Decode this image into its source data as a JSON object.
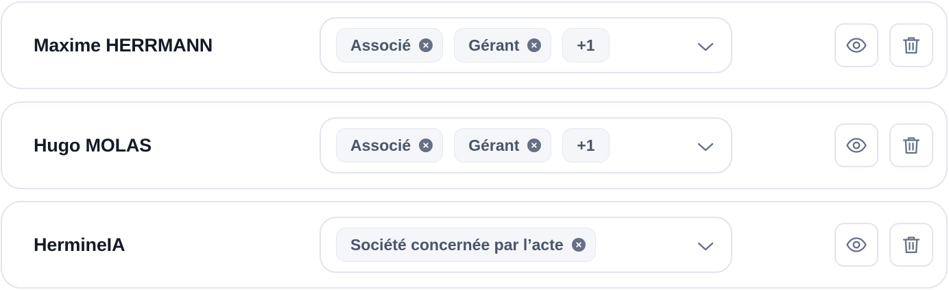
{
  "rows": [
    {
      "name": "Maxime HERRMANN",
      "chips": [
        {
          "label": "Associé",
          "remove_icon": "close-circle-icon"
        },
        {
          "label": "Gérant",
          "remove_icon": "close-circle-icon"
        }
      ],
      "more": "+1",
      "dropdown_icon": "chevron-down-icon",
      "actions": {
        "view_icon": "eye-icon",
        "delete_icon": "trash-icon"
      }
    },
    {
      "name": "Hugo MOLAS",
      "chips": [
        {
          "label": "Associé",
          "remove_icon": "close-circle-icon"
        },
        {
          "label": "Gérant",
          "remove_icon": "close-circle-icon"
        }
      ],
      "more": "+1",
      "dropdown_icon": "chevron-down-icon",
      "actions": {
        "view_icon": "eye-icon",
        "delete_icon": "trash-icon"
      }
    },
    {
      "name": "HermineIA",
      "chips": [
        {
          "label": "Société concernée par l’acte",
          "remove_icon": "close-circle-icon"
        }
      ],
      "more": "",
      "dropdown_icon": "chevron-down-icon",
      "actions": {
        "view_icon": "eye-icon",
        "delete_icon": "trash-icon"
      }
    }
  ],
  "colors": {
    "border": "#e2e5ee",
    "chip_bg": "#f4f6f9",
    "chip_text": "#4a5568",
    "icon": "#667085",
    "name_text": "#141a26"
  }
}
